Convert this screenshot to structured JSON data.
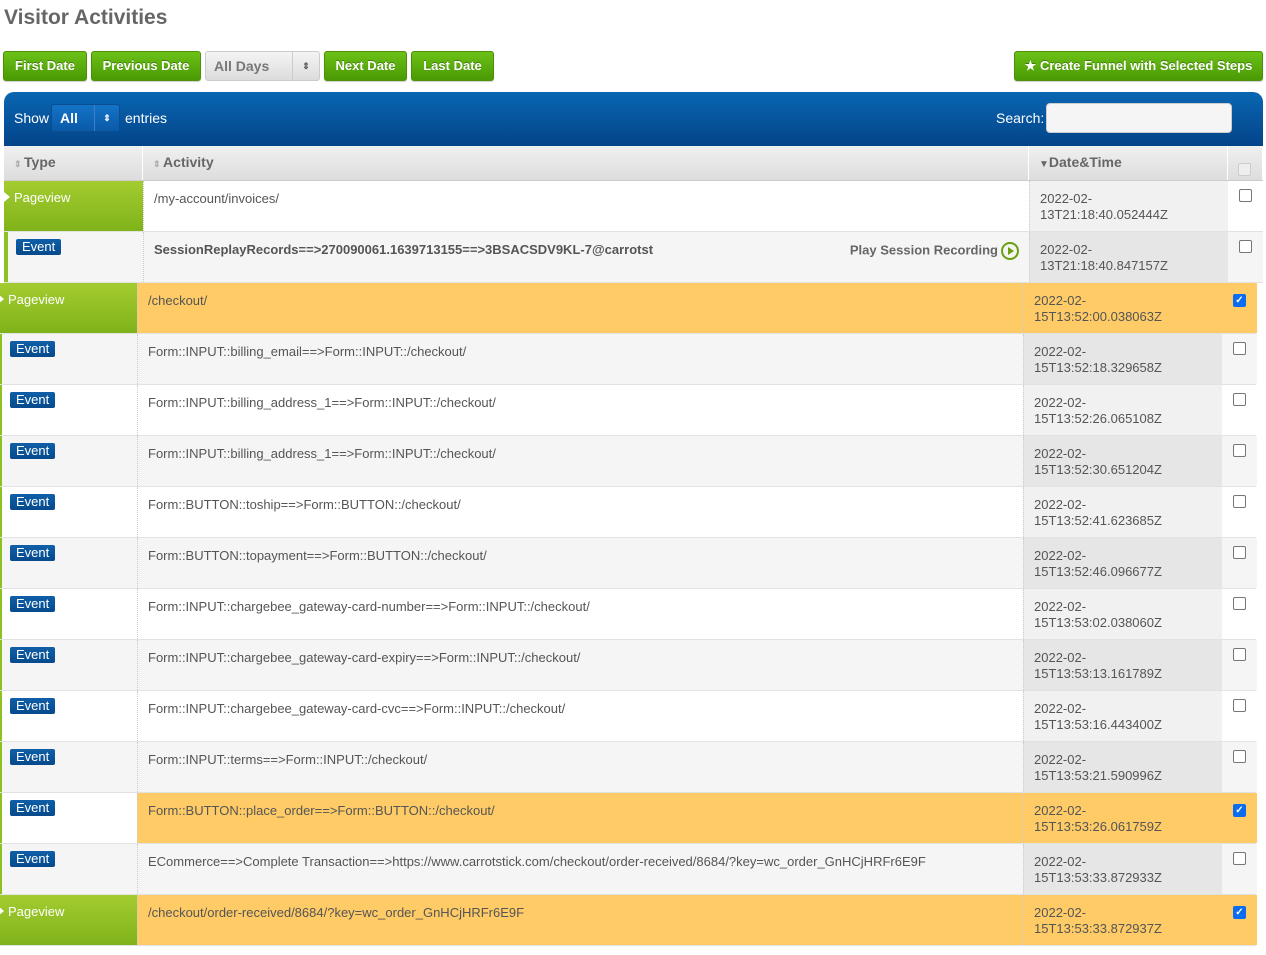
{
  "title": "Visitor Activities",
  "toolbar": {
    "first": "First Date",
    "previous": "Previous Date",
    "days_select": "All Days",
    "next": "Next Date",
    "last": "Last Date",
    "create_funnel": "★ Create Funnel with Selected Steps"
  },
  "table_controls": {
    "show": "Show",
    "length": "All",
    "entries": "entries",
    "search_label": "Search:",
    "search_value": ""
  },
  "columns": {
    "type": "Type",
    "activity": "Activity",
    "datetime": "Date&Time"
  },
  "play_label": "Play Session Recording",
  "rows": [
    {
      "type": "Pageview",
      "activity": "/my-account/invoices/",
      "datetime": "2022-02-13T21:18:40.052444Z",
      "checked": false
    },
    {
      "type": "Event",
      "activity": "SessionReplayRecords==>270090061.1639713155==>3BSACSDV9KL-7@carrotst",
      "datetime": "2022-02-13T21:18:40.847157Z",
      "checked": false,
      "play": true
    },
    {
      "type": "Pageview",
      "activity": "/checkout/",
      "datetime": "2022-02-15T13:52:00.038063Z",
      "checked": true
    },
    {
      "type": "Event",
      "activity": "Form::INPUT::billing_email==>Form::INPUT::/checkout/",
      "datetime": "2022-02-15T13:52:18.329658Z",
      "checked": false
    },
    {
      "type": "Event",
      "activity": "Form::INPUT::billing_address_1==>Form::INPUT::/checkout/",
      "datetime": "2022-02-15T13:52:26.065108Z",
      "checked": false
    },
    {
      "type": "Event",
      "activity": "Form::INPUT::billing_address_1==>Form::INPUT::/checkout/",
      "datetime": "2022-02-15T13:52:30.651204Z",
      "checked": false
    },
    {
      "type": "Event",
      "activity": "Form::BUTTON::toship==>Form::BUTTON::/checkout/",
      "datetime": "2022-02-15T13:52:41.623685Z",
      "checked": false
    },
    {
      "type": "Event",
      "activity": "Form::BUTTON::topayment==>Form::BUTTON::/checkout/",
      "datetime": "2022-02-15T13:52:46.096677Z",
      "checked": false
    },
    {
      "type": "Event",
      "activity": "Form::INPUT::chargebee_gateway-card-number==>Form::INPUT::/checkout/",
      "datetime": "2022-02-15T13:53:02.038060Z",
      "checked": false
    },
    {
      "type": "Event",
      "activity": "Form::INPUT::chargebee_gateway-card-expiry==>Form::INPUT::/checkout/",
      "datetime": "2022-02-15T13:53:13.161789Z",
      "checked": false
    },
    {
      "type": "Event",
      "activity": "Form::INPUT::chargebee_gateway-card-cvc==>Form::INPUT::/checkout/",
      "datetime": "2022-02-15T13:53:16.443400Z",
      "checked": false
    },
    {
      "type": "Event",
      "activity": "Form::INPUT::terms==>Form::INPUT::/checkout/",
      "datetime": "2022-02-15T13:53:21.590996Z",
      "checked": false
    },
    {
      "type": "Event",
      "activity": "Form::BUTTON::place_order==>Form::BUTTON::/checkout/",
      "datetime": "2022-02-15T13:53:26.061759Z",
      "checked": true
    },
    {
      "type": "Event",
      "activity": "ECommerce==>Complete Transaction==>https://www.carrotstick.com/checkout/order-received/8684/?key=wc_order_GnHCjHRFr6E9F",
      "datetime": "2022-02-15T13:53:33.872933Z",
      "checked": false
    },
    {
      "type": "Pageview",
      "activity": "/checkout/order-received/8684/?key=wc_order_GnHCjHRFr6E9F",
      "datetime": "2022-02-15T13:53:33.872937Z",
      "checked": true
    }
  ]
}
